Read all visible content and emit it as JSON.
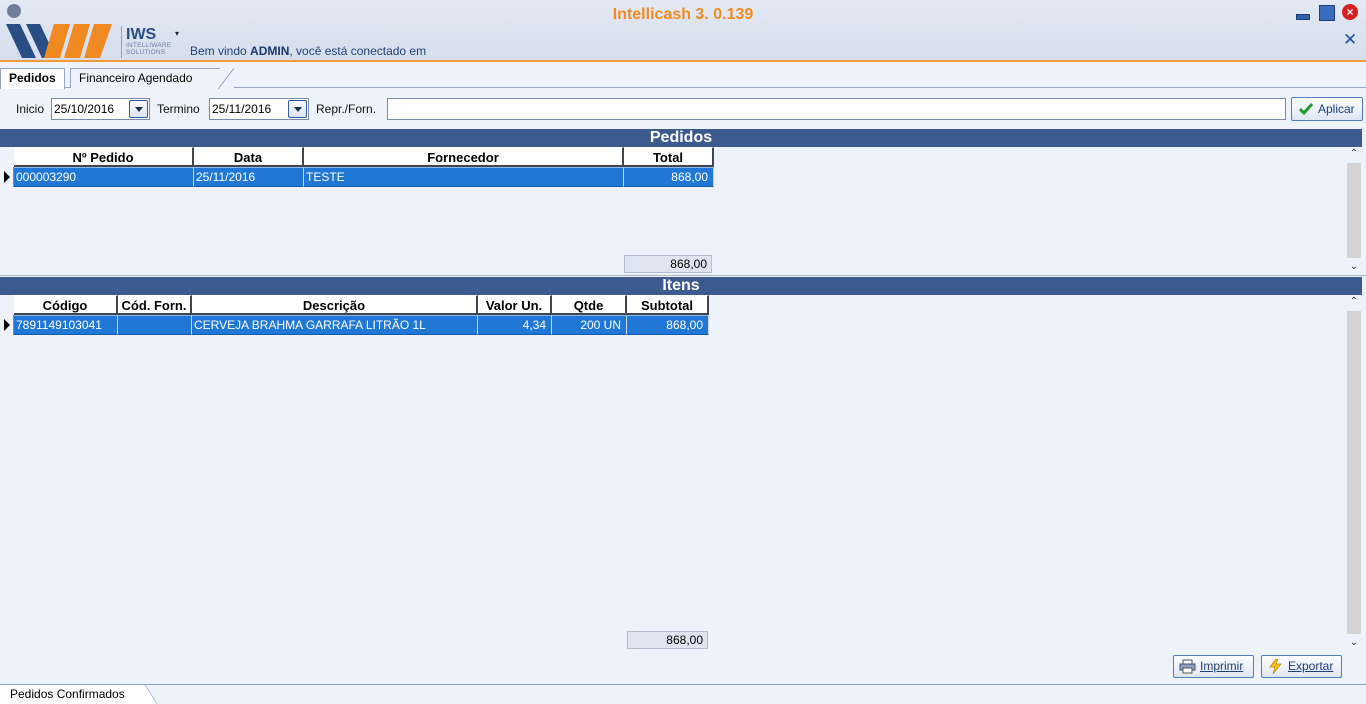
{
  "header": {
    "app_title": "Intellicash 3. 0.139",
    "logo_word": "IWS",
    "logo_tag_1": "INTELLIWARE",
    "logo_tag_2": "SOLUTIONS",
    "welcome_prefix": "Bem vindo ",
    "user": "ADMIN",
    "welcome_suffix": ", você está conectado em",
    "user_menu_glyph": "▾",
    "close_glyph": "×",
    "x_glyph": "✕"
  },
  "tabs": [
    {
      "label": "Pedidos",
      "active": true
    },
    {
      "label": "Financeiro Agendado",
      "active": false
    }
  ],
  "filter": {
    "inicio_label": "Inicio",
    "inicio_value": "25/10/2016",
    "termino_label": "Termino",
    "termino_value": "25/11/2016",
    "repr_label": "Repr./Forn.",
    "repr_value": "",
    "apply_label": "Aplicar"
  },
  "pedidos": {
    "title": "Pedidos",
    "columns": [
      "Nº Pedido",
      "Data",
      "Fornecedor",
      "Total"
    ],
    "rows": [
      {
        "numero": "000003290",
        "data": "25/11/2016",
        "fornecedor": "TESTE",
        "total": "868,00"
      }
    ],
    "footer_total": "868,00"
  },
  "itens": {
    "title": "Itens",
    "columns": [
      "Código",
      "Cód. Forn.",
      "Descrição",
      "Valor Un.",
      "Qtde",
      "Subtotal"
    ],
    "rows": [
      {
        "codigo": "7891149103041",
        "cod_forn": "",
        "descricao": "CERVEJA BRAHMA GARRAFA LITRÃO 1L",
        "valor_un": "4,34",
        "qtde": "200 UN",
        "subtotal": "868,00"
      }
    ],
    "footer_total": "868,00"
  },
  "actions": {
    "print_label": "Imprimir",
    "export_label": "Exportar"
  },
  "bottom_tab": "Pedidos Confirmados",
  "scroll": {
    "up_glyph": "⌃",
    "down_glyph": "⌄"
  },
  "colors": {
    "accent_orange": "#f08a20",
    "section_bar": "#3d5a8e",
    "selected_row": "#2077d6",
    "background": "#eef2fa"
  }
}
